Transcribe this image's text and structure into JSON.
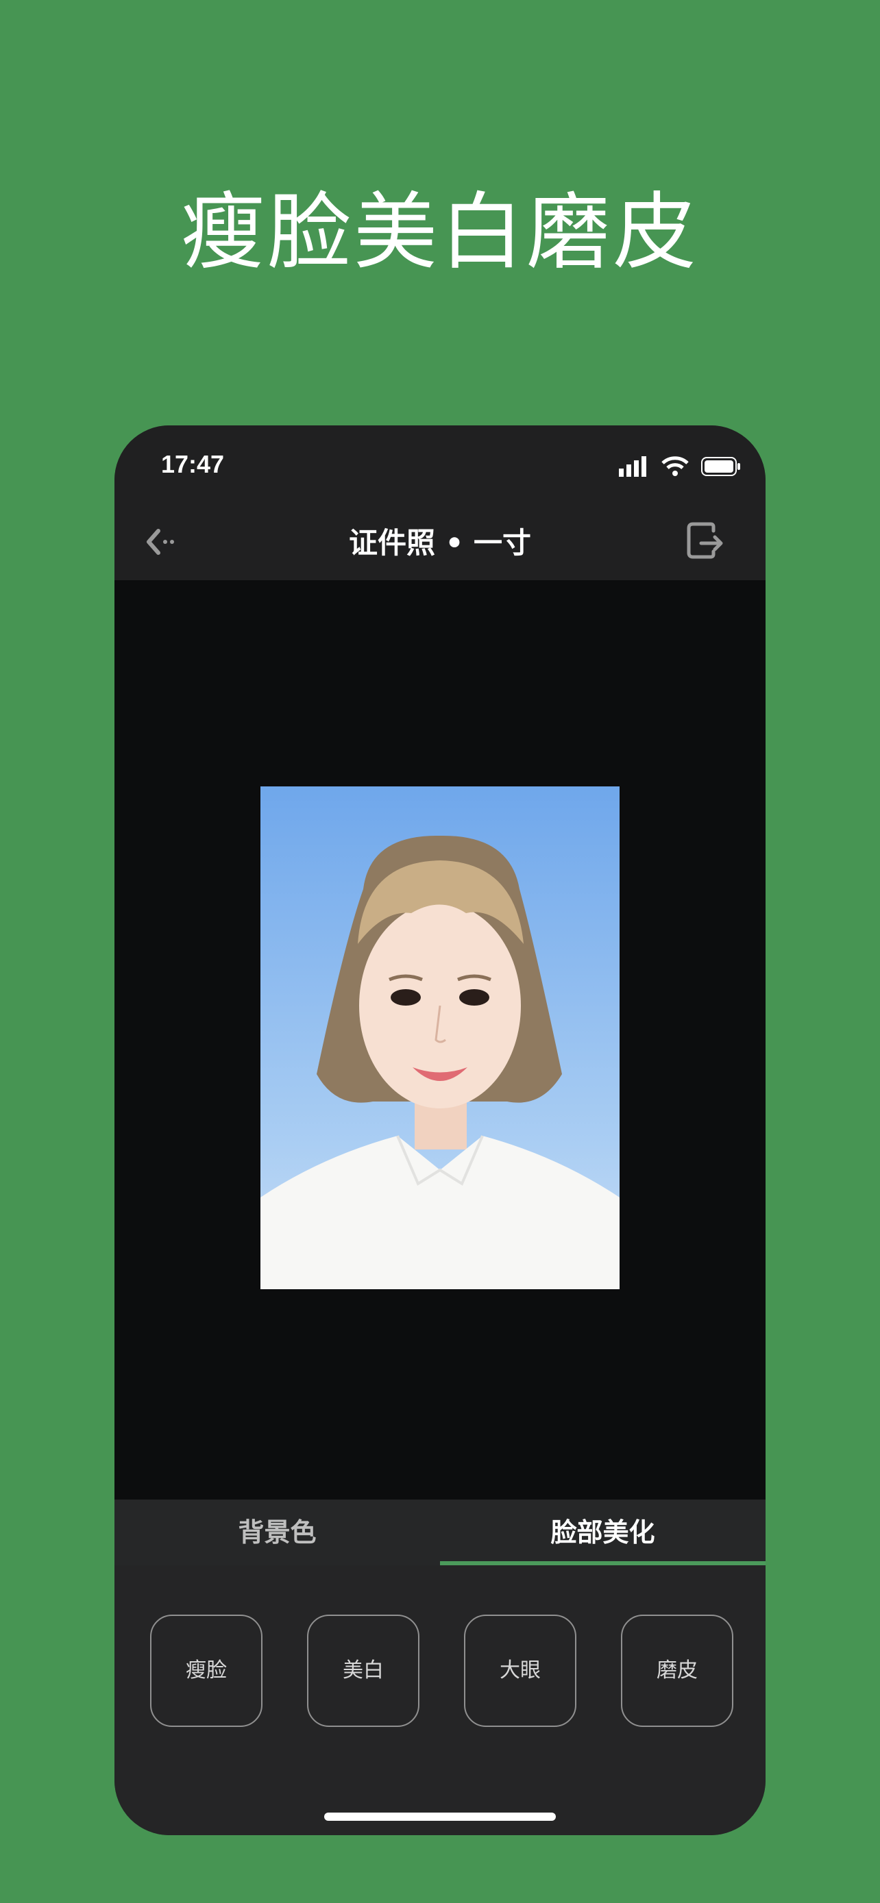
{
  "promo": {
    "title": "瘦脸美白磨皮"
  },
  "status_bar": {
    "time": "17:47"
  },
  "nav": {
    "title": "证件照 • 一寸",
    "back_icon": "back-arrow-icon",
    "share_icon": "share-icon"
  },
  "tabs": [
    {
      "label": "背景色",
      "active": false
    },
    {
      "label": "脸部美化",
      "active": true
    }
  ],
  "tools": [
    {
      "label": "瘦脸"
    },
    {
      "label": "美白"
    },
    {
      "label": "大眼"
    },
    {
      "label": "磨皮"
    }
  ],
  "colors": {
    "page_background": "#479553",
    "accent": "#4b9a5b",
    "photo_background": "#6fa7eb"
  }
}
